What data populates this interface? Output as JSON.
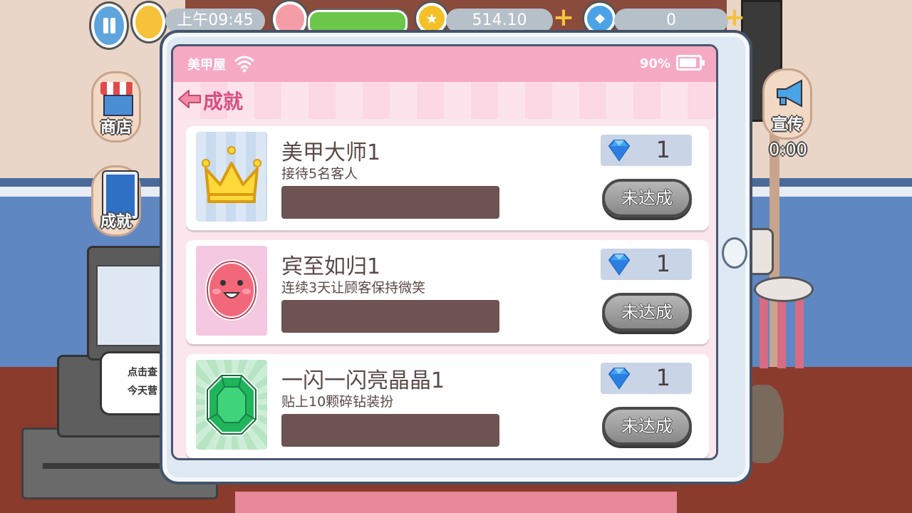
{
  "hud": {
    "time": "上午09:45",
    "coins": "514.10",
    "gems": "0"
  },
  "side": {
    "shop_label": "商店",
    "achievements_label": "成就",
    "promo_label": "宣传",
    "promo_timer": "0:00"
  },
  "register_tip": "点击查\n今天营",
  "tablet": {
    "status_title": "美甲屋",
    "battery": "90%",
    "battery_level": 0.9,
    "page_title": "成就",
    "achievements": [
      {
        "name": "美甲大师1",
        "desc": "接待5名客人",
        "reward": "1",
        "status": "未达成",
        "progress": 0,
        "icon": "crown-icon"
      },
      {
        "name": "宾至如归1",
        "desc": "连续3天让顾客保持微笑",
        "reward": "1",
        "status": "未达成",
        "progress": 0,
        "icon": "smiley-icon"
      },
      {
        "name": "一闪一闪亮晶晶1",
        "desc": "贴上10颗碎钻装扮",
        "reward": "1",
        "status": "未达成",
        "progress": 0,
        "icon": "emerald-icon"
      }
    ]
  },
  "colors": {
    "accent_pink": "#f6a9c3",
    "title_pink": "#d94f7c",
    "progress_bg": "#6e5353"
  }
}
